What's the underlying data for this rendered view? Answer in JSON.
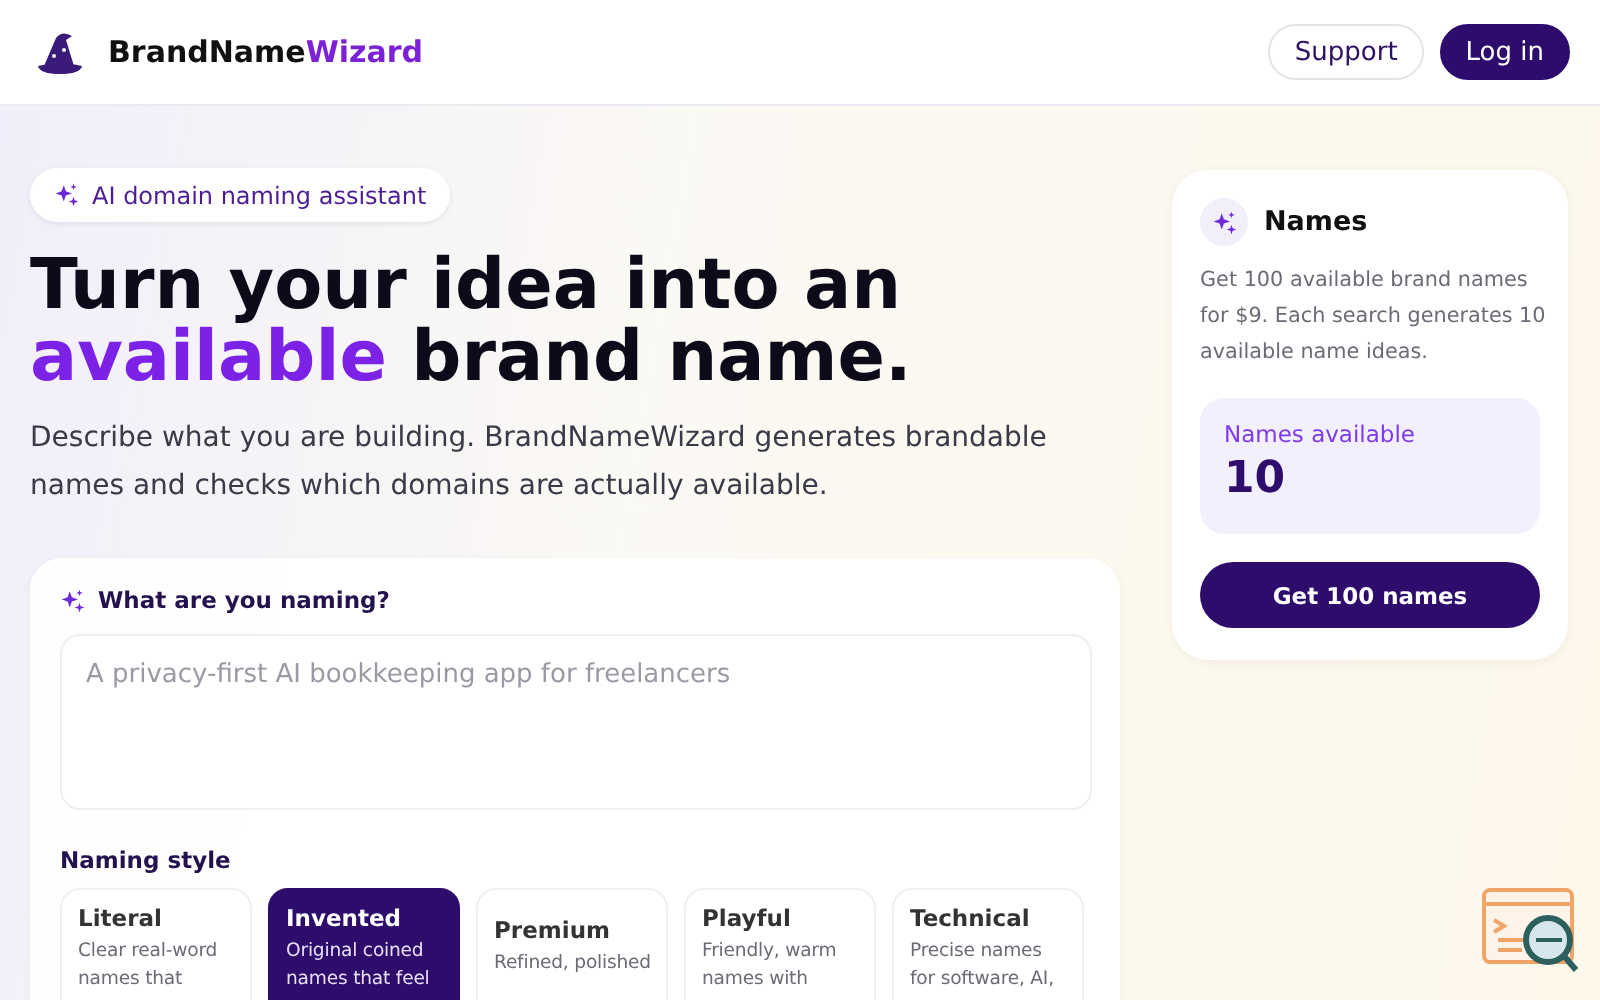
{
  "header": {
    "brand": {
      "first": "BrandName",
      "second": "Wizard"
    },
    "buttons": [
      {
        "label": "Support",
        "kind": "outline"
      },
      {
        "label": "Log in",
        "kind": "solid"
      }
    ]
  },
  "hero": {
    "badge": "AI domain naming assistant",
    "title_line1": "Turn your idea into an",
    "title_highlight": "available",
    "title_rest": "brand name.",
    "description": "Describe what you are building. BrandNameWizard generates brandable names and checks which domains are actually available."
  },
  "form": {
    "prompt_label": "What are you naming?",
    "idea_field": {
      "placeholder": "A privacy-first AI bookkeeping app for freelancers"
    },
    "style_label": "Naming style",
    "styles": [
      {
        "name": "Literal",
        "description": "Clear real-word names that",
        "selected": false
      },
      {
        "name": "Invented",
        "description": "Original coined names that feel",
        "selected": true
      },
      {
        "name": "Premium",
        "description": "Refined, polished",
        "selected": false
      },
      {
        "name": "Playful",
        "description": "Friendly, warm names with",
        "selected": false
      },
      {
        "name": "Technical",
        "description": "Precise names for software, AI,",
        "selected": false
      }
    ]
  },
  "names_card": {
    "title": "Names",
    "description": "Get 100 available brand names for $9. Each search generates 10 available name ideas.",
    "available_label": "Names available",
    "available_count": "10",
    "button": "Get 100 names"
  }
}
